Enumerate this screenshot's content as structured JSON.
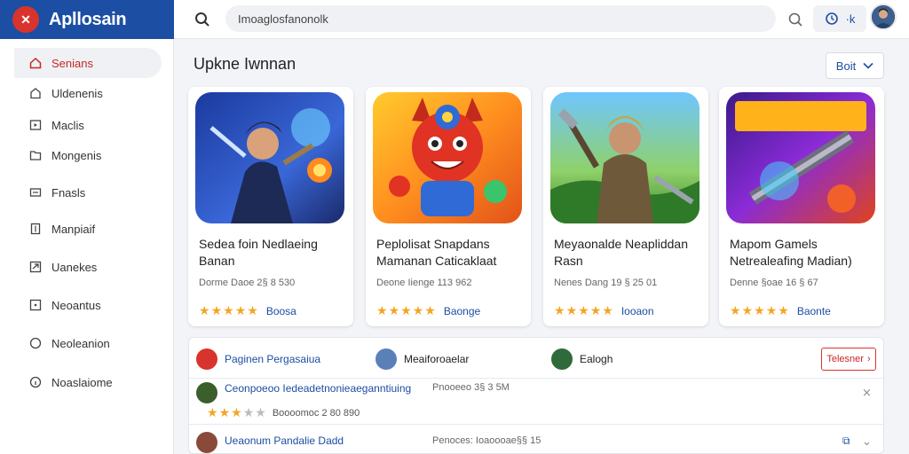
{
  "app": {
    "name": "Apllosain",
    "logo_glyph": "✕"
  },
  "search": {
    "value": "Imoaglosfanonolk",
    "placeholder": ""
  },
  "account": {
    "label": "·k"
  },
  "sidebar": {
    "items": [
      {
        "label": "Senians",
        "icon": "home-icon",
        "active": true
      },
      {
        "label": "Uldenenis",
        "icon": "bookmark-icon",
        "active": false
      },
      {
        "label": "Maclis",
        "icon": "play-icon",
        "active": false
      },
      {
        "label": "Mongenis",
        "icon": "folder-icon",
        "active": false
      },
      {
        "label": "Fnasls",
        "icon": "message-icon",
        "active": false
      },
      {
        "label": "Manpiaif",
        "icon": "document-icon",
        "active": false
      },
      {
        "label": "Uanekes",
        "icon": "share-icon",
        "active": false
      },
      {
        "label": "Neoantus",
        "icon": "plus-box-icon",
        "active": false
      },
      {
        "label": "Neoleanion",
        "icon": "circle-icon",
        "active": false
      },
      {
        "label": "Noaslaiome",
        "icon": "info-icon",
        "active": false
      }
    ]
  },
  "main": {
    "title": "Upkne Iwnnan",
    "sort_label": "Boit"
  },
  "cards": [
    {
      "title": "Sedea foin Nedlaeing Banan",
      "meta": "Dorme Daoe 2§ 8 530",
      "rating": 5,
      "score": "Boosa"
    },
    {
      "title": "Peplolisat Snapdans Mamanan Caticaklaat",
      "meta": "Deone Iienge 113 962",
      "rating": 5,
      "score": "Baonge"
    },
    {
      "title": "Meyaonalde Neapliddan Rasn",
      "meta": "Nenes Dang 19 § 25 01",
      "rating": 5,
      "score": "Iooaon"
    },
    {
      "title": "Mapom Gamels Netrealeafing Madian)",
      "meta": "Denne §oae 16 § 67",
      "rating": 5,
      "score": "Baonte"
    }
  ],
  "categories": [
    {
      "label": "Paginen Pergasaiua"
    },
    {
      "label": "Meaiforoaelar"
    },
    {
      "label": "Ealogh"
    }
  ],
  "category_button": "Telesner",
  "list_rows": [
    {
      "name": "Ceonpoeoo Iedeadetnonieaeganntiuing",
      "sub": "Pnooeeo 3§ 3 5M",
      "rating": 3,
      "score": "Boooomoс 2 80 890"
    },
    {
      "name": "Ueaonum Pandalie Dadd",
      "sub": "Penoces: Ioaoooae§§ 15",
      "rating": 0,
      "score": ""
    }
  ],
  "colors": {
    "brand": "#1c4ea3",
    "accent": "#d8332c",
    "star": "#f2a626"
  }
}
